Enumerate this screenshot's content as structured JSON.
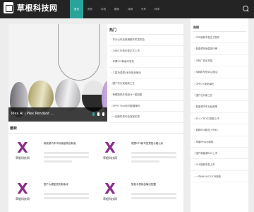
{
  "site": {
    "name": "草根科技网"
  },
  "nav": [
    "首页",
    "资讯",
    "手机",
    "数码",
    "评测",
    "汽车",
    "科学"
  ],
  "hero": {
    "caption": "Plex AI | Plex Pendant ..."
  },
  "hot": {
    "title": "热门",
    "items": [
      "华为公布全新旗舰手机发布会",
      "小米GTE新车型正式上市",
      "苹果iOS新版本发布",
      "三星折叠屏L系列新品曝光",
      "国产芯片突破新工艺",
      "荣耀新机外观设计+渲染图",
      "OPPO Find系列配置曝光",
      "一加新机发布会官宣定档",
      "vivo新品全面屏手机上市"
    ]
  },
  "latest": {
    "title": "最新",
    "thumb_text": "草根科技网",
    "cards": [
      {
        "title": "新能源汽车市场销量再创新高"
      },
      {
        "title": "理想GTE新车型预售价格公布"
      },
      {
        "title": "国产大模型发布新版本"
      },
      {
        "title": "智能手表新品曝光配置"
      }
    ]
  },
  "side": {
    "title": "热榜",
    "items": [
      "GTE新款车型正式发布",
      "新能源车销量排行榜",
      "手机厂商出货量",
      "i6新款车型4S店到店",
      "OPPO+新机曝光",
      "国产芯片新工艺",
      "新能源汽车补贴政策",
      "ID.4 CROZZ新款上市",
      "新款K50新品上市4S",
      "苹果iPhone新款",
      "国产新能源SUV上市",
      "GL8新款车型上市",
      "一汽MAXUS EV78新款"
    ]
  },
  "colors": {
    "accent": "#2aa39b",
    "topbar": "#242424",
    "logo_x": "#8a2e8c"
  }
}
